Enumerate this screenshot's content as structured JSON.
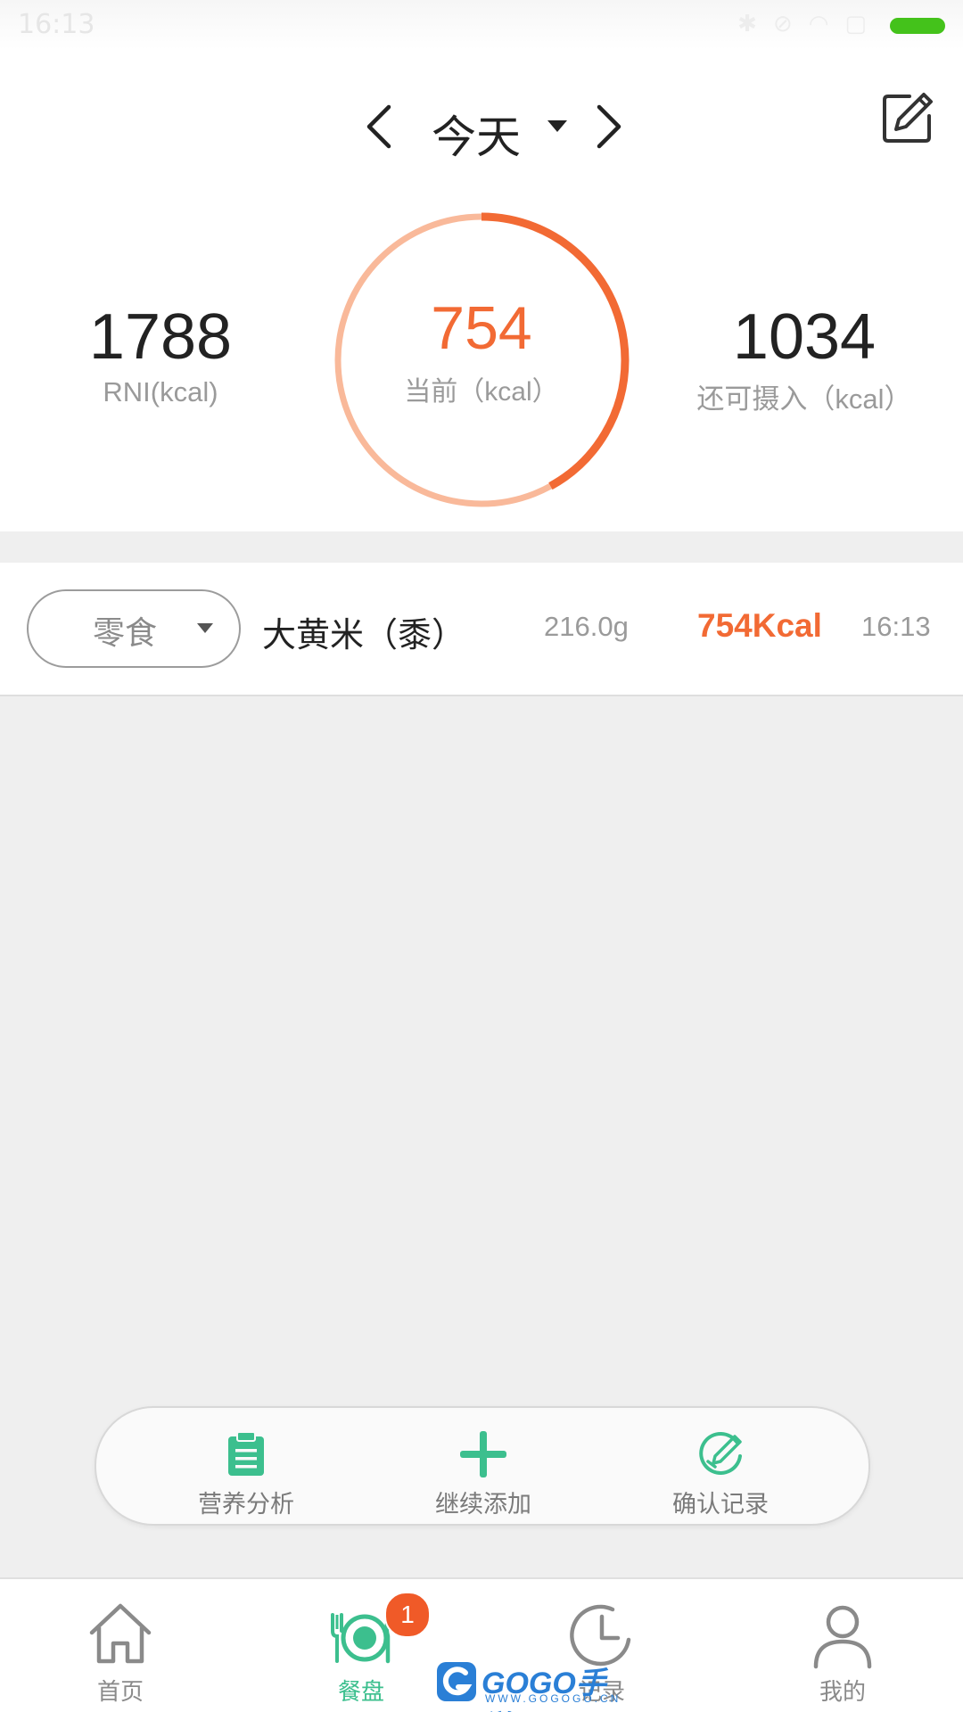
{
  "status_bar": {
    "time": "16:13",
    "icons": [
      "bluetooth-icon",
      "mute-icon",
      "wifi-icon",
      "sim-icon"
    ],
    "battery_color": "#44c21b"
  },
  "header": {
    "date_label": "今天",
    "prev_icon": "chevron-left-icon",
    "next_icon": "chevron-right-icon",
    "edit_icon": "edit-icon"
  },
  "summary": {
    "rni_value": "1788",
    "rni_label": "RNI(kcal)",
    "current_value": "754",
    "current_label": "当前（kcal）",
    "remaining_value": "1034",
    "remaining_label": "还可摄入（kcal）",
    "progress_fraction": 0.42,
    "ring_track_color": "#f9b99a",
    "ring_progress_color": "#f26a34"
  },
  "entries": [
    {
      "meal": "零食",
      "food": "大黄米（黍）",
      "weight": "216.0g",
      "kcal": "754Kcal",
      "time": "16:13"
    }
  ],
  "actions": {
    "analysis_label": "营养分析",
    "add_label": "继续添加",
    "confirm_label": "确认记录",
    "accent_color": "#3cbf8e"
  },
  "tabs": {
    "home_label": "首页",
    "plate_label": "餐盘",
    "plate_badge": "1",
    "history_label": "记录",
    "me_label": "我的"
  },
  "watermark": {
    "text": "GOGO手游网",
    "sub": "WWW.GOGOGO.CN"
  }
}
